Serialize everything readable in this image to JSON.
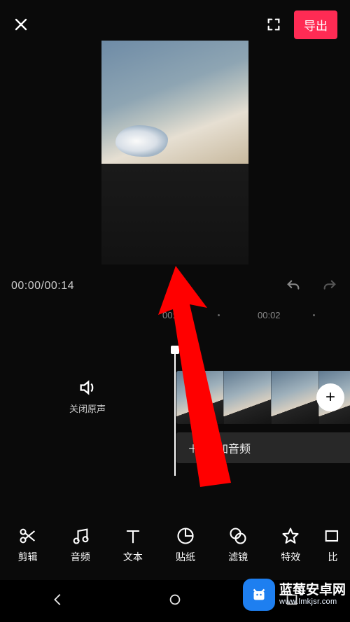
{
  "topbar": {
    "export_label": "导出"
  },
  "transport": {
    "time_display": "00:00/00:14"
  },
  "ruler": {
    "marks": [
      "00:00",
      "00:02"
    ]
  },
  "timeline": {
    "mute_label": "关闭原声",
    "add_audio_label": "添加音频"
  },
  "tools": [
    {
      "id": "edit",
      "label": "剪辑"
    },
    {
      "id": "audio",
      "label": "音频"
    },
    {
      "id": "text",
      "label": "文本"
    },
    {
      "id": "sticker",
      "label": "贴纸"
    },
    {
      "id": "filter",
      "label": "滤镜"
    },
    {
      "id": "effect",
      "label": "特效"
    },
    {
      "id": "ratio",
      "label": "比"
    }
  ],
  "watermark": {
    "title": "蓝莓安卓网",
    "url": "www.lmkjsr.com"
  }
}
